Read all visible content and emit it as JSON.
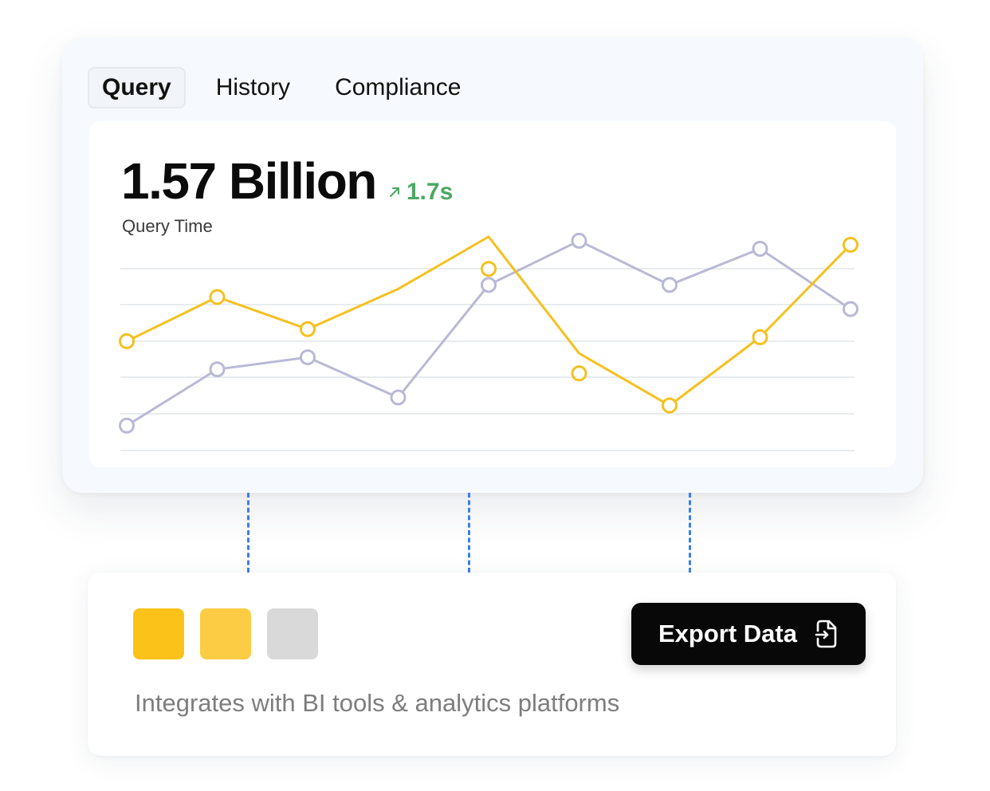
{
  "tabs": [
    {
      "label": "Query",
      "active": true
    },
    {
      "label": "History",
      "active": false
    },
    {
      "label": "Compliance",
      "active": false
    }
  ],
  "metric": {
    "value": "1.57 Billion",
    "delta": "1.7s",
    "delta_icon": "arrow-up-right-icon",
    "label": "Query Time"
  },
  "colors": {
    "series_primary": "#f4c11f",
    "series_secondary": "#b9b9d6",
    "delta": "#4aa863",
    "swatch_1": "#fbc21a",
    "swatch_2": "#fccd44",
    "swatch_3": "#d9d9d9",
    "connector": "#3a7ef0"
  },
  "chart_data": {
    "type": "line",
    "x": [
      1,
      2,
      3,
      4,
      5,
      6,
      7,
      8,
      9
    ],
    "grid": true,
    "ylim": [
      0,
      5
    ],
    "series": [
      {
        "color": "#f4c11f",
        "values": [
          2.7,
          3.8,
          3.0,
          4.5,
          1.9,
          1.1,
          2.8,
          5.1
        ],
        "points": [
          1,
          2,
          3,
          5,
          6,
          7,
          8,
          9
        ],
        "line_points": [
          1,
          2,
          3,
          4,
          5,
          6,
          7,
          8,
          9
        ],
        "line_values": [
          2.7,
          3.8,
          3.0,
          4.0,
          5.3,
          2.4,
          1.1,
          2.8,
          5.1
        ]
      },
      {
        "color": "#b9b9d6",
        "values": [
          0.6,
          2.0,
          2.3,
          1.3,
          4.1,
          5.2,
          4.1,
          5.0,
          3.5
        ],
        "points": [
          1,
          2,
          3,
          4,
          5,
          6,
          7,
          8,
          9
        ]
      }
    ]
  },
  "bottom": {
    "export_label": "Export Data",
    "export_icon": "export-file-icon",
    "caption": "Integrates with BI tools & analytics platforms"
  }
}
